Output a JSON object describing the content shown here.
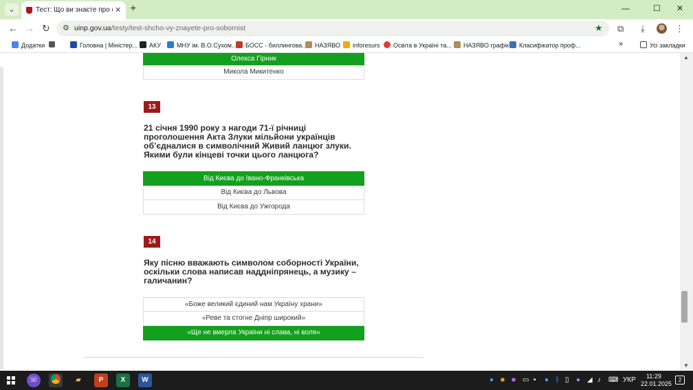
{
  "tab": {
    "title": "Тест: Що ви знаєте про собор"
  },
  "address": {
    "host": "uinp.gov.ua",
    "path": "/testy/test-shcho-vy-znayete-pro-sobornist"
  },
  "bookmarks": [
    {
      "label": "Додатки",
      "icon": "apps-grid-icon",
      "color": "#4285f4"
    },
    {
      "label": "Головна | Міністер...",
      "icon": "ministry-icon",
      "color": "#1a4fa0"
    },
    {
      "label": "АКУ",
      "icon": "bird-icon",
      "color": "#222222"
    },
    {
      "label": "МНУ ім. В.О.Сухом...",
      "icon": "university-icon",
      "color": "#2a7bd6"
    },
    {
      "label": "БОСС - биллингова...",
      "icon": "boss-icon",
      "color": "#c0392b"
    },
    {
      "label": "НАЗЯВО",
      "icon": "trident-icon",
      "color": "#b08d57"
    },
    {
      "label": "inforesurs",
      "icon": "info-icon",
      "color": "#f2a900"
    },
    {
      "label": "Освіта в Україні та...",
      "icon": "opera-icon",
      "color": "#e53935"
    },
    {
      "label": "НАЗЯВО графік",
      "icon": "trident-icon",
      "color": "#b08d57"
    },
    {
      "label": "Класифікатор проф...",
      "icon": "classifier-icon",
      "color": "#3b6fb6"
    }
  ],
  "all_bookmarks": "Усі закладки",
  "prev_answers": [
    {
      "text": "Олекса Гірник",
      "correct": true
    },
    {
      "text": "Микола Микитенко",
      "correct": false
    }
  ],
  "questions": [
    {
      "number": "13",
      "text": "21 січня 1990 року з нагоди 71-ї річниці проголошення Акта Злуки мільйони українців об’єдналися в символічний Живий ланцюг злуки. Якими були кінцеві точки цього ланцюга?",
      "answers": [
        {
          "text": "Від Києва до Івано-Франківська",
          "correct": true
        },
        {
          "text": "Від Києва до Львова",
          "correct": false
        },
        {
          "text": "Від Києва до Ужгорода",
          "correct": false
        }
      ]
    },
    {
      "number": "14",
      "text": "Яку пісню вважають символом соборності України, оскільки слова написав наддніпрянець, а музику – галичанин?",
      "answers": [
        {
          "text": "«Боже великий єдиний нам Україну храни»",
          "correct": false
        },
        {
          "text": "«Реве та стогне Дніпр широкий»",
          "correct": false
        },
        {
          "text": "«Ще не вмерла України ні слава, ні воля»",
          "correct": true
        }
      ]
    }
  ],
  "taskbar": {
    "apps": [
      "viber",
      "chrome",
      "explorer",
      "powerpoint",
      "excel",
      "word"
    ],
    "language": "УКР",
    "time": "11:29",
    "date": "22.01.2025",
    "notifications": "2"
  },
  "colors": {
    "correct": "#14a01f",
    "qnum": "#9b1b1b",
    "tabstrip": "#d4ecc4"
  }
}
